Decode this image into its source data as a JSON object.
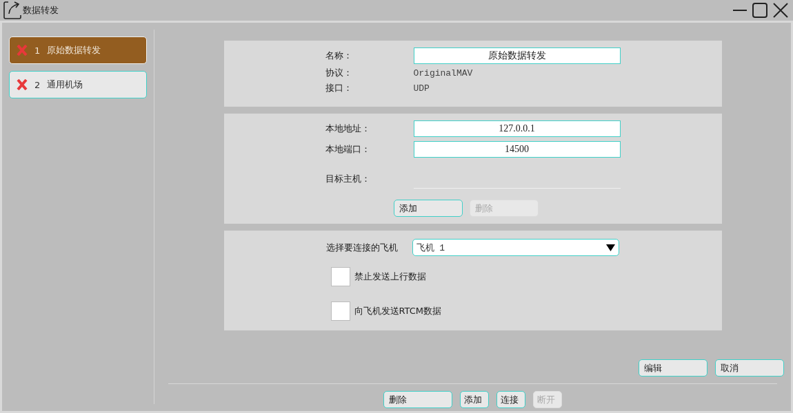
{
  "window": {
    "title": "数据转发"
  },
  "connections": [
    {
      "number": "1",
      "name": "原始数据转发",
      "selected": true
    },
    {
      "number": "2",
      "name": "通用机场",
      "selected": false
    }
  ],
  "general": {
    "fields": [
      {
        "kind": "input",
        "label": "名称：",
        "value": "原始数据转发"
      },
      {
        "kind": "text",
        "label": "协议：",
        "value": "OriginalMAV"
      },
      {
        "kind": "text",
        "label": "接口：",
        "value": "UDP"
      }
    ]
  },
  "network": {
    "fields": [
      {
        "kind": "input",
        "label": "本地地址：",
        "value": "127.0.0.1"
      },
      {
        "kind": "input",
        "label": "本地端口：",
        "value": "14500"
      }
    ],
    "target_host_label": "目标主机：",
    "buttons": [
      {
        "label": "添加",
        "disabled": false
      },
      {
        "label": "删除",
        "disabled": true
      }
    ]
  },
  "vehicle": {
    "label": "选择要连接的飞机",
    "selected_value": "飞机 1",
    "options": [
      {
        "label": "禁止发送上行数据",
        "checked": false
      },
      {
        "label": "向飞机发送RTCM数据",
        "checked": false
      }
    ]
  },
  "form_buttons": [
    {
      "label": "编辑",
      "disabled": false
    },
    {
      "label": "取消",
      "disabled": false
    }
  ],
  "bottom_buttons": [
    {
      "label": "删除",
      "disabled": false,
      "wide": true
    },
    {
      "label": "添加",
      "disabled": false,
      "wide": false
    },
    {
      "label": "连接",
      "disabled": false,
      "wide": false
    },
    {
      "label": "断开",
      "disabled": true,
      "wide": false
    }
  ]
}
